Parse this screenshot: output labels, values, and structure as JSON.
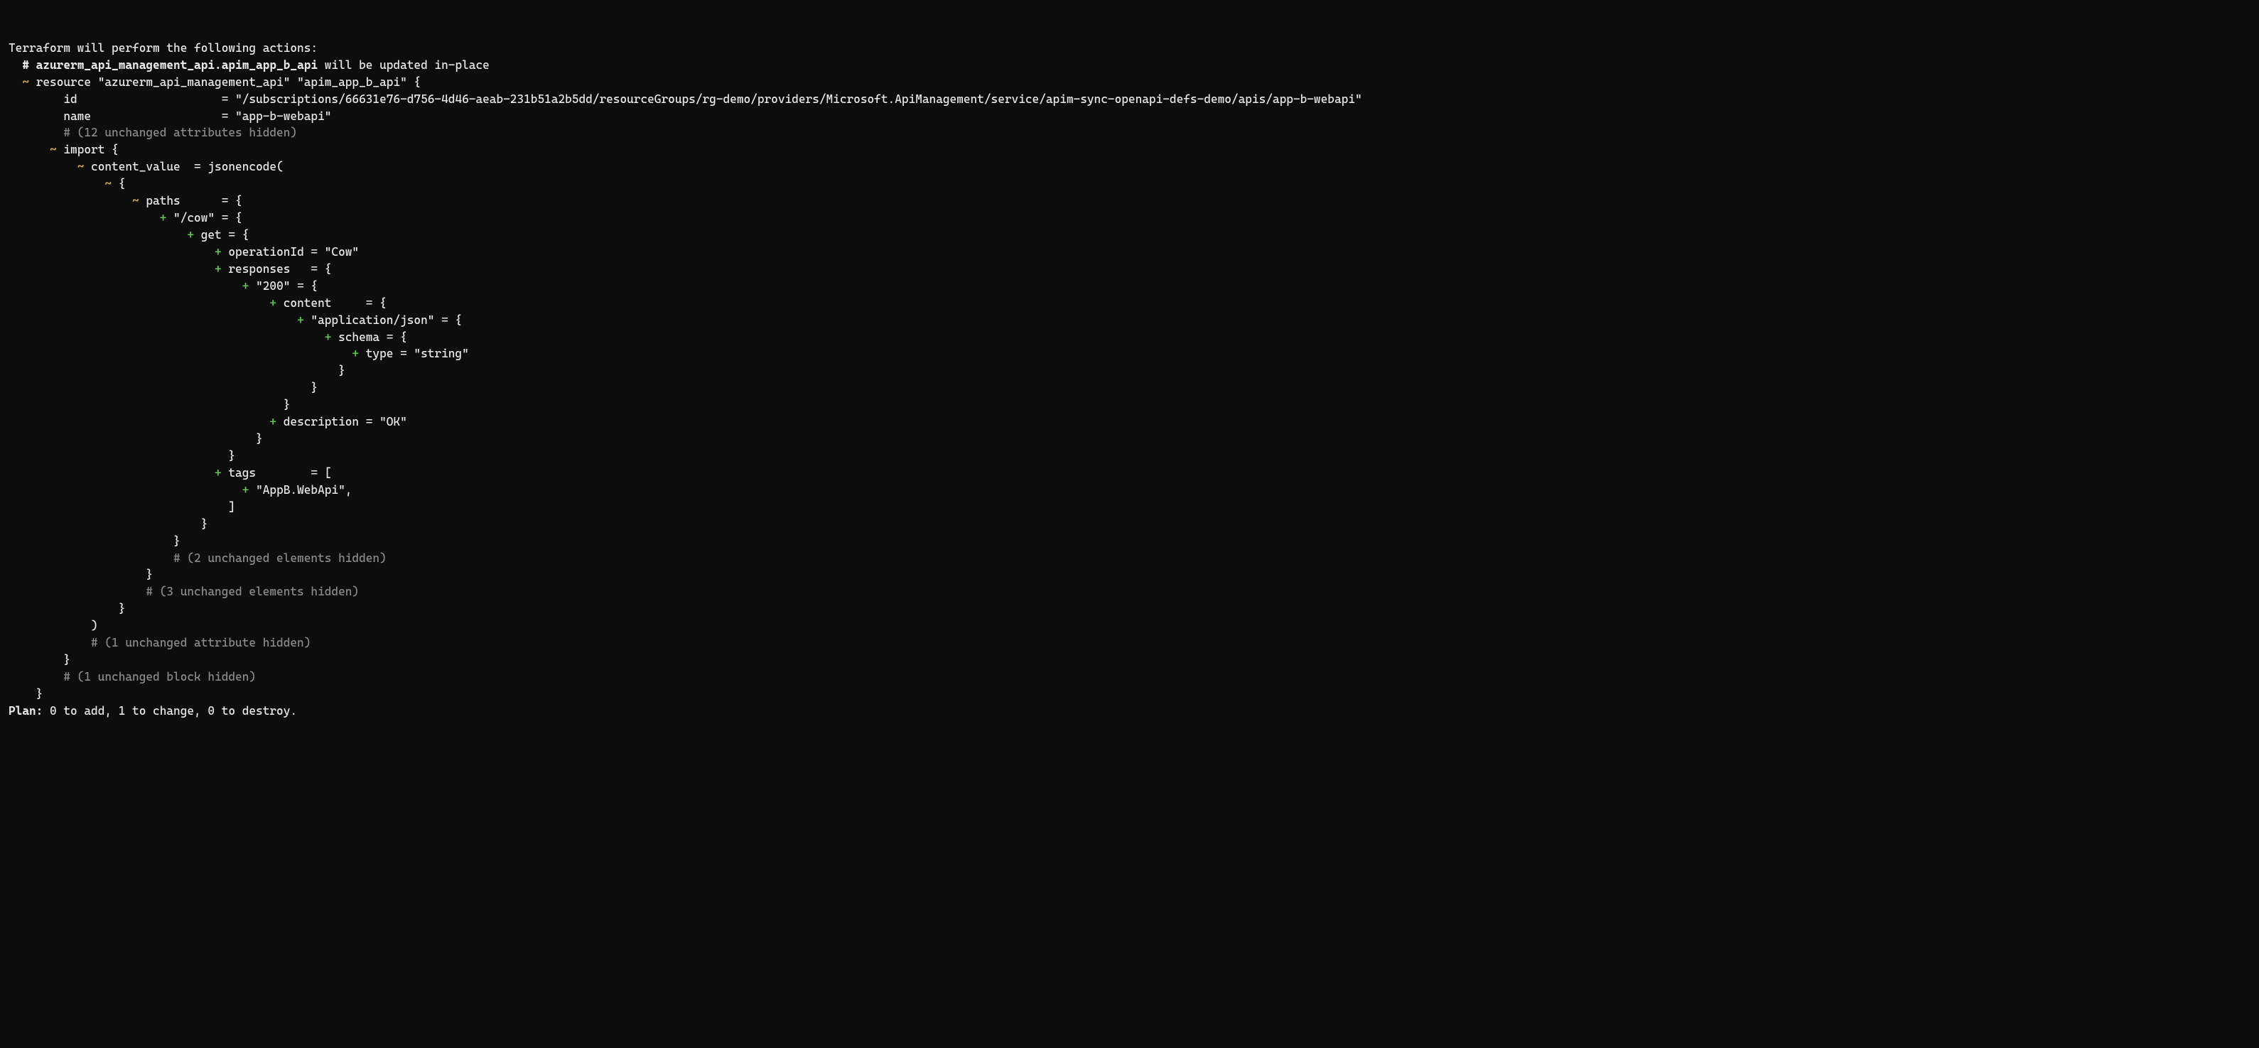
{
  "header": "Terraform will perform the following actions:",
  "resourceComment": "# azurerm_api_management_api.apim_app_b_api",
  "updateNote": " will be updated in-place",
  "resourceDecl": "resource \"azurerm_api_management_api\" \"apim_app_b_api\" {",
  "idKey": "id",
  "idVal": "\"/subscriptions/66631e76-d756-4d46-aeab-231b51a2b5dd/resourceGroups/rg-demo/providers/Microsoft.ApiManagement/service/apim-sync-openapi-defs-demo/apis/app-b-webapi\"",
  "nameKey": "name",
  "nameVal": "\"app-b-webapi\"",
  "attrsHidden12": "# (12 unchanged attributes hidden)",
  "importOpen": "import {",
  "contentValue": "content_value  = jsonencode(",
  "braceOpen1": "{",
  "pathsLine": "paths      = {",
  "cowLine": "\"/cow\" = {",
  "getLine": "get = {",
  "opIdLine": "operationId = \"Cow\"",
  "responsesLine": "responses   = {",
  "r200Line": "\"200\" = {",
  "contentLine": "content     = {",
  "appJsonLine": "\"application/json\" = {",
  "schemaLine": "schema = {",
  "typeLine": "type = \"string\"",
  "closeBrace": "}",
  "descLine": "description = \"OK\"",
  "tagsOpen": "tags        = [",
  "tagItem": "\"AppB.WebApi\",",
  "closeBracket": "]",
  "elements2": "# (2 unchanged elements hidden)",
  "elements3": "# (3 unchanged elements hidden)",
  "closeParen": ")",
  "attr1": "# (1 unchanged attribute hidden)",
  "block1": "# (1 unchanged block hidden)",
  "planLabel": "Plan:",
  "planText": " 0 to add, 1 to change, 0 to destroy."
}
